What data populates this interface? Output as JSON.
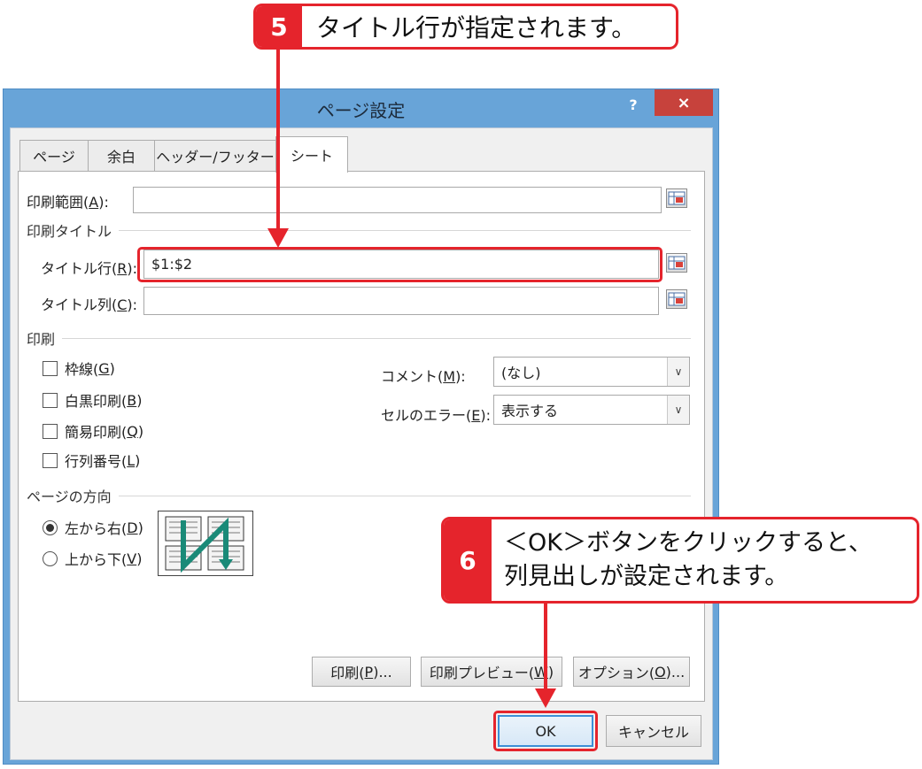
{
  "callout5": {
    "number": "5",
    "text": "タイトル行が指定されます。"
  },
  "callout6": {
    "number": "6",
    "line1": "＜OK＞ボタンをクリックすると、",
    "line2": "列見出しが設定されます。"
  },
  "dialog": {
    "title": "ページ設定",
    "help": "?",
    "close": "×",
    "tabs": [
      {
        "label": "ページ"
      },
      {
        "label": "余白"
      },
      {
        "label": "ヘッダー/フッター"
      },
      {
        "label": "シート"
      }
    ],
    "print_area": {
      "label": "印刷範囲(",
      "accel": "A",
      "suffix": "):",
      "value": ""
    },
    "print_titles_group": "印刷タイトル",
    "title_rows": {
      "label": "タイトル行(",
      "accel": "R",
      "suffix": "):",
      "value": "$1:$2"
    },
    "title_cols": {
      "label": "タイトル列(",
      "accel": "C",
      "suffix": "):",
      "value": ""
    },
    "print_group": "印刷",
    "checkboxes": [
      {
        "label": "枠線(",
        "accel": "G",
        "suffix": ")"
      },
      {
        "label": "白黒印刷(",
        "accel": "B",
        "suffix": ")"
      },
      {
        "label": "簡易印刷(",
        "accel": "Q",
        "suffix": ")"
      },
      {
        "label": "行列番号(",
        "accel": "L",
        "suffix": ")"
      }
    ],
    "comments": {
      "label": "コメント(",
      "accel": "M",
      "suffix": "):",
      "value": "(なし)"
    },
    "cell_errors": {
      "label": "セルのエラー(",
      "accel": "E",
      "suffix": "):",
      "value": "表示する"
    },
    "page_order_group": "ページの方向",
    "radios": [
      {
        "label": "左から右(",
        "accel": "D",
        "suffix": ")",
        "selected": true
      },
      {
        "label": "上から下(",
        "accel": "V",
        "suffix": ")",
        "selected": false
      }
    ],
    "buttons": {
      "print": {
        "label": "印刷(",
        "accel": "P",
        "suffix": ")..."
      },
      "preview": {
        "label": "印刷プレビュー(",
        "accel": "W",
        "suffix": ")"
      },
      "options": {
        "label": "オプション(",
        "accel": "O",
        "suffix": ")..."
      },
      "ok": "OK",
      "cancel": "キャンセル"
    }
  },
  "colors": {
    "accent_red": "#e5242c",
    "titlebar": "#68a4d8",
    "close_button": "#c7423c",
    "order_arrow": "#1a8a78"
  }
}
